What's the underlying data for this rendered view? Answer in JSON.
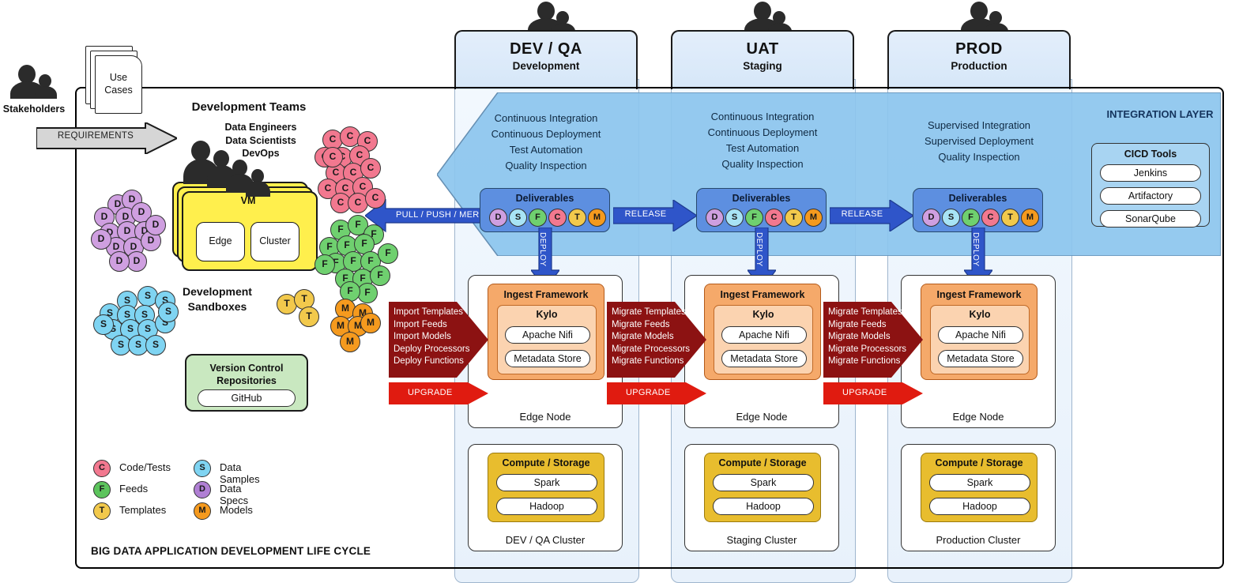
{
  "diagram": {
    "title": "BIG DATA APPLICATION DEVELOPMENT LIFE CYCLE"
  },
  "left": {
    "stakeholders_label": "Stakeholders",
    "use_cases_label_1": "Use",
    "use_cases_label_2": "Cases",
    "requirements_label": "REQUIREMENTS",
    "dev_teams_title": "Development Teams",
    "roles": [
      "Data Engineers",
      "Data Scientists",
      "DevOps"
    ],
    "vm_label": "VM",
    "vm_edge": "Edge",
    "vm_cluster": "Cluster",
    "sandboxes_line1": "Development",
    "sandboxes_line2": "Sandboxes",
    "vcs_title_line1": "Version Control",
    "vcs_title_line2": "Repositories",
    "vcs_tool": "GitHub"
  },
  "legend": [
    {
      "key": "C",
      "label": "Code/Tests",
      "color": "#f2788f"
    },
    {
      "key": "F",
      "label": "Feeds",
      "color": "#5cc45c"
    },
    {
      "key": "T",
      "label": "Templates",
      "color": "#f2c94c"
    },
    {
      "key": "S",
      "label": "Data Samples",
      "color": "#7fd4f2"
    },
    {
      "key": "D",
      "label": "Data Specs",
      "color": "#b07fd4"
    },
    {
      "key": "M",
      "label": "Models",
      "color": "#f59a1e"
    }
  ],
  "artifact_colors": {
    "D": "#cf9fe0",
    "S": "#a8e4f5",
    "F": "#6fd06f",
    "C": "#f2788f",
    "T": "#f2c94c",
    "M": "#f59a1e"
  },
  "deliverable_keys": [
    "D",
    "S",
    "F",
    "C",
    "T",
    "M"
  ],
  "environments": [
    {
      "id": "dev",
      "title": "DEV / QA",
      "subtitle": "Development",
      "practices": [
        "Continuous Integration",
        "Continuous Deployment",
        "Test Automation",
        "Quality Inspection"
      ],
      "deliverables_label": "Deliverables",
      "deploy_label": "DEPLOY",
      "edge_node_caption": "Edge Node",
      "ingest_title": "Ingest Framework",
      "kylo_title": "Kylo",
      "kylo_items": [
        "Apache Nifi",
        "Metadata Store"
      ],
      "compute_title": "Compute / Storage",
      "compute_items": [
        "Spark",
        "Hadoop"
      ],
      "cluster_caption": "DEV / QA Cluster"
    },
    {
      "id": "uat",
      "title": "UAT",
      "subtitle": "Staging",
      "practices": [
        "Continuous Integration",
        "Continuous Deployment",
        "Test Automation",
        "Quality Inspection"
      ],
      "deliverables_label": "Deliverables",
      "deploy_label": "DEPLOY",
      "edge_node_caption": "Edge Node",
      "ingest_title": "Ingest Framework",
      "kylo_title": "Kylo",
      "kylo_items": [
        "Apache Nifi",
        "Metadata Store"
      ],
      "compute_title": "Compute / Storage",
      "compute_items": [
        "Spark",
        "Hadoop"
      ],
      "cluster_caption": "Staging Cluster"
    },
    {
      "id": "prod",
      "title": "PROD",
      "subtitle": "Production",
      "practices": [
        "Supervised Integration",
        "Supervised Deployment",
        "Quality Inspection"
      ],
      "deliverables_label": "Deliverables",
      "deploy_label": "DEPLOY",
      "edge_node_caption": "Edge Node",
      "ingest_title": "Ingest Framework",
      "kylo_title": "Kylo",
      "kylo_items": [
        "Apache Nifi",
        "Metadata Store"
      ],
      "compute_title": "Compute / Storage",
      "compute_items": [
        "Spark",
        "Hadoop"
      ],
      "cluster_caption": "Production Cluster"
    }
  ],
  "integration": {
    "layer_label": "INTEGRATION LAYER",
    "cicd_title": "CICD Tools",
    "cicd_tools": [
      "Jenkins",
      "Artifactory",
      "SonarQube"
    ]
  },
  "flows": {
    "pull_push_merge": "PULL / PUSH / MERGE",
    "release_1": "RELEASE",
    "release_2": "RELEASE",
    "import_actions": [
      "Import Templates",
      "Import Feeds",
      "Import Models",
      "Deploy Processors",
      "Deploy Functions"
    ],
    "migrate_actions": [
      "Migrate Templates",
      "Migrate Feeds",
      "Migrate Models",
      "Migrate Processors",
      "Migrate Functions"
    ],
    "upgrade_label": "UPGRADE"
  },
  "colors": {
    "blue_arrow": "#2f55c9",
    "dark_red": "#8c1212",
    "bright_red": "#e01b10",
    "integration_fill": "#8dc6ee"
  }
}
